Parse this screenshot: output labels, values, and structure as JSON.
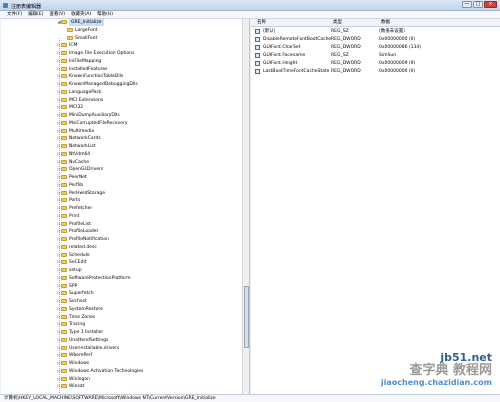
{
  "window": {
    "title": "注册表编辑器",
    "buttons": [
      "—",
      "□",
      "×"
    ]
  },
  "menu": {
    "items": [
      "文件(F)",
      "编辑(E)",
      "查看(V)",
      "收藏夹(A)",
      "帮助(H)"
    ]
  },
  "tree": {
    "selected": "GRE_Initialize",
    "children": [
      "LargeFont",
      "SmallFont"
    ],
    "items": [
      "GRE_Initialize",
      "LargeFont",
      "SmallFont",
      "ICM",
      "Image File Execution Options",
      "IniFileMapping",
      "InstalledFeatures",
      "KnownFunctionTableDlls",
      "KnownManagedDebuggingDlls",
      "LanguagePack",
      "MCI Extensions",
      "MCI32",
      "MiniDumpAuxiliaryDlls",
      "MsiCorruptedFileRecovery",
      "Multimedia",
      "NetworkCards",
      "NetworkList",
      "NtVdm64",
      "NvCache",
      "OpenGLDrivers",
      "PeerNet",
      "Perflib",
      "PerHwIdStorage",
      "Ports",
      "Prefetcher",
      "Print",
      "ProfileList",
      "ProfileLoader",
      "ProfileNotification",
      "related.desc",
      "Schedule",
      "SeCEdit",
      "setup",
      "SoftwareProtectionPlatform",
      "SPP",
      "Superfetch",
      "Svchost",
      "SystemRestore",
      "Time Zones",
      "Tracing",
      "Type 1 Installer",
      "UnattendSettings",
      "Userinstallable.drivers",
      "WbemPerf",
      "Windows",
      "Windows Activation Technologies",
      "Winlogon",
      "Winsat"
    ]
  },
  "values": {
    "headers": [
      "名称",
      "类型",
      "数据"
    ],
    "rows": [
      {
        "name": "(默认)",
        "type": "REG_SZ",
        "data": "(数值未设置)"
      },
      {
        "name": "DisableRemoteFontBootCache",
        "type": "REG_DWORD",
        "data": "0x00000000 (0)"
      },
      {
        "name": "GUIFont.CharSet",
        "type": "REG_DWORD",
        "data": "0x00000086 (134)"
      },
      {
        "name": "GUIFont.Facename",
        "type": "REG_SZ",
        "data": "SimSun"
      },
      {
        "name": "GUIFont.Height",
        "type": "REG_DWORD",
        "data": "0x00000009 (9)"
      },
      {
        "name": "LastBootTimeFontCacheState",
        "type": "REG_DWORD",
        "data": "0x00000000 (0)"
      }
    ]
  },
  "status": {
    "path": "计算机\\HKEY_LOCAL_MACHINE\\SOFTWARE\\Microsoft\\Windows NT\\CurrentVersion\\GRE_Initialize"
  },
  "watermark": {
    "line1": "jb51.net",
    "line2": "查字典 教程网",
    "line3": "jiaocheng.chazidian.com"
  }
}
